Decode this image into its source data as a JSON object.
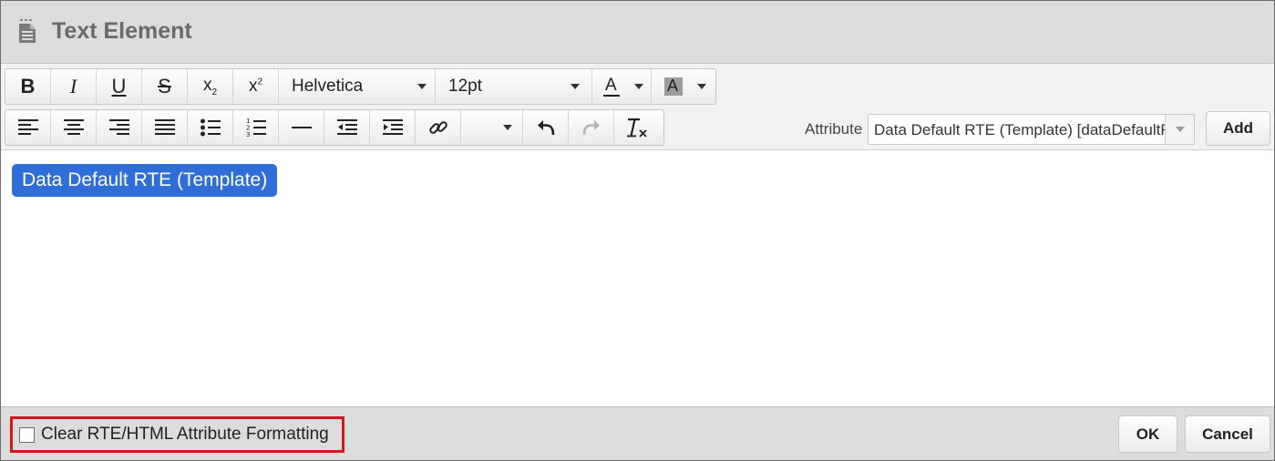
{
  "dialog": {
    "title": "Text Element"
  },
  "toolbar": {
    "row1": {
      "bold": "B",
      "italic": "I",
      "underline": "U",
      "strikethrough": "S",
      "subscript": "x",
      "subscript_mark": "2",
      "superscript": "x",
      "superscript_mark": "2",
      "font_family": "Helvetica",
      "font_size": "12pt",
      "text_color_glyph": "A",
      "bg_color_glyph": "A"
    },
    "attribute": {
      "label": "Attribute",
      "value": "Data Default RTE (Template) [dataDefaultRTE]",
      "add_label": "Add"
    }
  },
  "editor": {
    "chip_text": "Data Default RTE (Template)"
  },
  "footer": {
    "clear_label": "Clear RTE/HTML Attribute Formatting",
    "clear_checked": false,
    "ok_label": "OK",
    "cancel_label": "Cancel"
  },
  "colors": {
    "chip": "#2f6ed8",
    "highlight_border": "#d5161d",
    "titlebar": "#dcdcdc"
  },
  "icons": {
    "title": "document-icon",
    "row2": [
      "align-left-icon",
      "align-center-icon",
      "align-right-icon",
      "align-justify-icon",
      "bullet-list-icon",
      "numbered-list-icon",
      "horizontal-rule-icon",
      "outdent-icon",
      "indent-icon",
      "link-icon",
      "undo-icon",
      "redo-icon",
      "clear-formatting-icon"
    ]
  }
}
